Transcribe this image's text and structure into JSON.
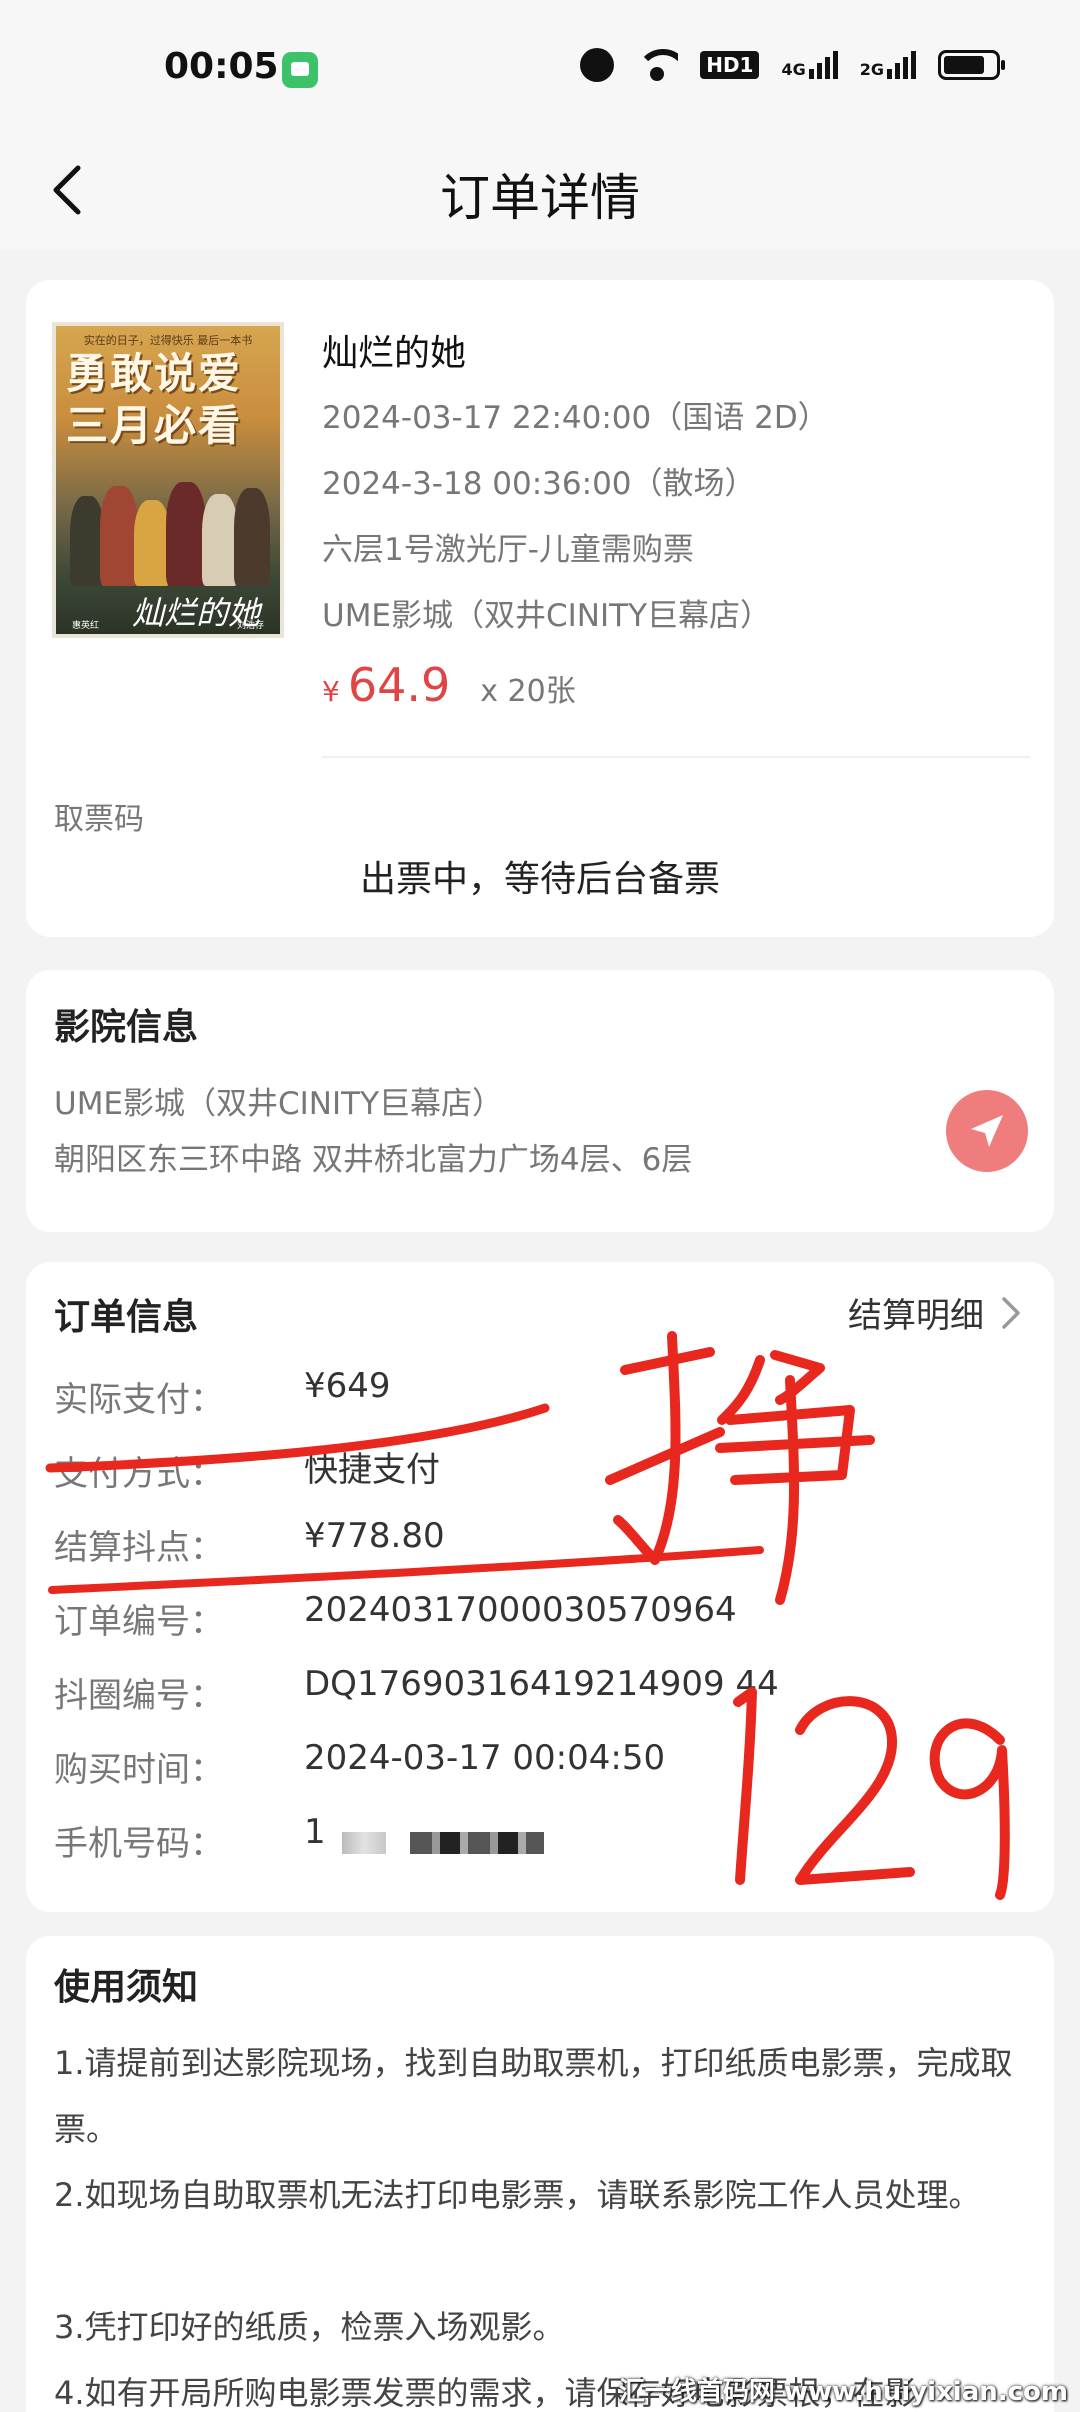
{
  "status_bar": {
    "time": "00:05",
    "network_4g": "4G",
    "network_2g": "2G",
    "hd": "HD1"
  },
  "header": {
    "title": "订单详情"
  },
  "movie": {
    "poster_small_text": "实在的日子，过得快乐 最后一本书",
    "poster_title_line1": "勇敢说爱",
    "poster_title_line2": "三月必看",
    "poster_logo": "灿烂的她",
    "poster_sub_left": "惠英红",
    "poster_sub_right": "刘浩存",
    "name": "灿烂的她",
    "start_time": "2024-03-17 22:40:00（国语 2D）",
    "end_time": "2024-3-18 00:36:00（散场）",
    "hall": "六层1号激光厅-儿童需购票",
    "cinema": "UME影城（双井CINITY巨幕店）",
    "price_currency": "¥",
    "price": "64.9",
    "quantity": "x 20张"
  },
  "ticket": {
    "code_label": "取票码",
    "status": "出票中，等待后台备票"
  },
  "cinema_info": {
    "title": "影院信息",
    "name": "UME影城（双井CINITY巨幕店）",
    "address": "朝阳区东三环中路 双井桥北富力广场4层、6层"
  },
  "order_info": {
    "title": "订单信息",
    "settlement_link": "结算明细",
    "rows": [
      {
        "label": "实际支付：",
        "value": "¥649"
      },
      {
        "label": "支付方式：",
        "value": "快捷支付"
      },
      {
        "label": "结算抖点：",
        "value": "¥778.80"
      },
      {
        "label": "订单编号：",
        "value": "20240317000030570964"
      },
      {
        "label": "抖圈编号：",
        "value": "DQ17690316419214909 44"
      },
      {
        "label": "购买时间：",
        "value": "2024-03-17 00:04:50"
      },
      {
        "label": "手机号码：",
        "value": "1"
      }
    ]
  },
  "annotations": {
    "handwritten_1": "挣",
    "handwritten_2": "129",
    "ink_color": "#e8281e"
  },
  "notice": {
    "title": "使用须知",
    "items": [
      "1.请提前到达影院现场，找到自助取票机，打印纸质电影票，完成取票。",
      "2.如现场自助取票机无法打印电影票，请联系影院工作人员处理。",
      "3.凭打印好的纸质，检票入场观影。",
      "4.如有开局所购电影票发票的需求，请保存好电影票根，在影"
    ]
  },
  "watermark": "汇一线首码网 www.huiyixian.com",
  "colors": {
    "price_red": "#e14444",
    "nav_button": "#f07d7d",
    "background": "#f3f3f3"
  }
}
